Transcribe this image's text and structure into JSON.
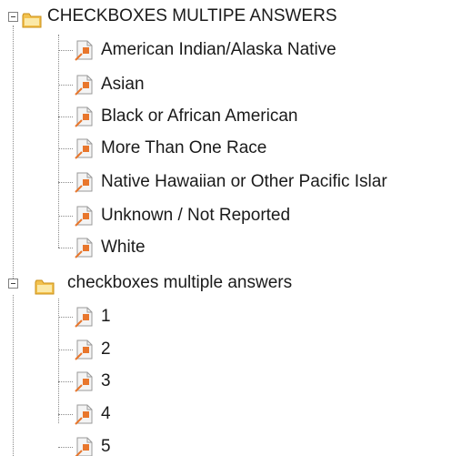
{
  "tree": {
    "groups": [
      {
        "label": "CHECKBOXES MULTIPE ANSWERS",
        "icon": "folder-icon",
        "expanded": true,
        "items": [
          "American Indian/Alaska Native",
          "Asian",
          "Black or African American",
          "More Than One Race",
          "Native Hawaiian or Other Pacific Islar",
          "Unknown / Not Reported",
          "White"
        ]
      },
      {
        "label": "checkboxes multiple answers",
        "icon": "folder-icon",
        "expanded": true,
        "items": [
          "1",
          "2",
          "3",
          "4",
          "5"
        ]
      }
    ]
  },
  "colors": {
    "folder_fill": "#f2c14e",
    "folder_tab": "#e5a823",
    "leaf_page": "#f4f4f4",
    "leaf_accent": "#e8762c",
    "tree_line": "#8a8a8a"
  }
}
